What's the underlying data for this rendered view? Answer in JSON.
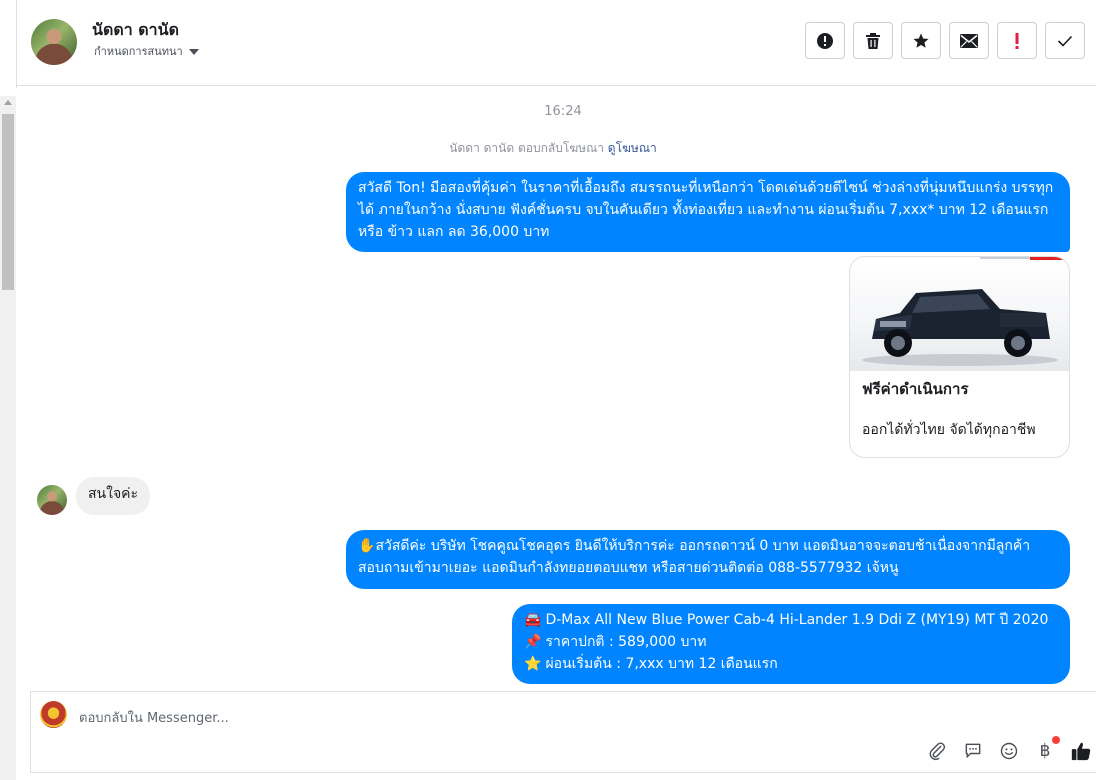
{
  "header": {
    "contact_name": "นัดดา ดานัด",
    "subtitle": "กำหนดการสนทนา",
    "toolbar": [
      {
        "name": "info-button",
        "icon": "info-icon"
      },
      {
        "name": "delete-button",
        "icon": "trash-icon"
      },
      {
        "name": "star-button",
        "icon": "star-icon"
      },
      {
        "name": "mark-unread-button",
        "icon": "envelope-icon"
      },
      {
        "name": "spam-button",
        "icon": "exclamation-icon"
      },
      {
        "name": "done-button",
        "icon": "check-icon"
      }
    ]
  },
  "conversation": {
    "timestamp": "16:24",
    "reply_note": {
      "text": "นัดดา ดานัด ตอบกลับโฆษณา",
      "link": "ดูโฆษณา"
    },
    "messages": [
      {
        "direction": "outgoing",
        "text": "สวัสดี Ton! มือสองที่คุ้มค่า ในราคาที่เอื้อมถึง สมรรถนะที่เหนือกว่า โดดเด่นด้วยดีไซน์ ช่วงล่างที่นุ่มหนึบแกร่ง บรรทุกได้ ภายในกว้าง นั่งสบาย ฟังค์ชั่นครบ จบในคันเดียว ทั้งท่องเที่ยว และทำงาน ผ่อนเริ่มต้น 7,xxx* บาท 12 เดือนแรก หรือ ข้าว แลก ลด 36,000 บาท"
      },
      {
        "direction": "outgoing",
        "type": "card",
        "title": "ฟรีค่าดำเนินการ",
        "description": "ออกได้ทั่วไทย จัดได้ทุกอาชีพ"
      },
      {
        "direction": "incoming",
        "text": "สนใจค่ะ"
      },
      {
        "direction": "outgoing",
        "emoji": "✋",
        "text": "สวัสดีค่ะ บริษัท โชคคูณโชคอุดร ยินดีให้บริการค่ะ ออกรถดาวน์ 0 บาท แอดมินอาจจะตอบช้าเนื่องจากมีลูกค้าสอบถามเข้ามาเยอะ แอดมินกำลังทยอยตอบแชท หรือสายด่วนติดต่อ 088-5577932 เจ้หนู"
      },
      {
        "direction": "outgoing",
        "lines": [
          {
            "emoji": "🚘",
            "text": "D-Max All New Blue Power Cab-4 Hi-Lander 1.9 Ddi Z (MY19) MT ปี 2020"
          },
          {
            "emoji": "📌",
            "text": "ราคาปกติ : 589,000 บาท"
          },
          {
            "emoji": "⭐",
            "text": "ผ่อนเริ่มต้น : 7,xxx บาท 12 เดือนแรก"
          }
        ]
      }
    ]
  },
  "composer": {
    "placeholder": "ตอบกลับใน Messenger..."
  },
  "colors": {
    "outgoing_bubble": "#0084ff",
    "incoming_bubble": "#f1f0f0",
    "link": "#365899",
    "notification_dot": "#fa3e3e"
  }
}
